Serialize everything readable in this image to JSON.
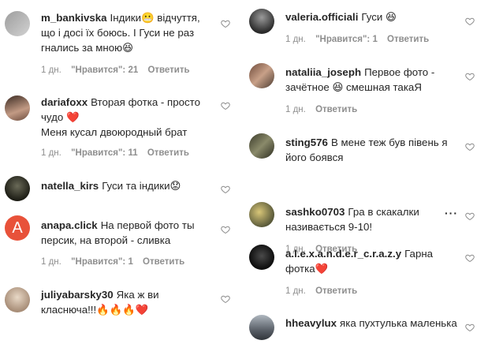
{
  "left": [
    {
      "username": "m_bankivska",
      "text": "Індики😬 відчуття, що і досі їх боюсь. І Гуси не раз гнались за мною😆",
      "time": "1 дн.",
      "likes": "\"Нравится\": 21",
      "reply": "Ответить"
    },
    {
      "username": "dariafoxx",
      "text": "Вторая фотка - просто чудо ❤️",
      "text2": "Меня кусал двоюродный брат",
      "time": "1 дн.",
      "likes": "\"Нравится\": 11",
      "reply": "Ответить"
    },
    {
      "username": "natella_kirs",
      "text": "Гуси та індики😟",
      "time": "",
      "likes": "",
      "reply": ""
    },
    {
      "username": "anapa.click",
      "text": "На первой фото ты персик, на второй - сливка",
      "avatar_letter": "A",
      "time": "1 дн.",
      "likes": "\"Нравится\": 1",
      "reply": "Ответить"
    },
    {
      "username": "juliyabarsky30",
      "text": "Яка ж ви класнюча!!!🔥🔥🔥❤️",
      "time": "",
      "likes": "",
      "reply": ""
    }
  ],
  "right": [
    {
      "username": "valeria.officiali",
      "text": "Гуси 😆",
      "time": "1 дн.",
      "likes": "\"Нравится\": 1",
      "reply": "Ответить"
    },
    {
      "username": "nataliia_joseph",
      "text": "Первое фото - зачётное 😆 смешная такаЯ",
      "time": "1 дн.",
      "likes": "",
      "reply": "Ответить"
    },
    {
      "username": "sting576",
      "text": "В мене теж був півень я його боявся",
      "time": "",
      "likes": "",
      "reply": ""
    },
    {
      "username": "sashko0703",
      "text": "Гра в скакалки називається 9-10!",
      "time": "1 дн.",
      "likes": "",
      "reply": "Ответить"
    },
    {
      "username": "a.l.e.x.a.n.d.e.r_c.r.a.z.y",
      "text": "Гарна фотка❤️",
      "time": "1 дн.",
      "likes": "",
      "reply": "Ответить"
    },
    {
      "username": "hheavylux",
      "text": "яка пухтулька маленька",
      "time": "",
      "likes": "",
      "reply": ""
    }
  ],
  "icons": {
    "like": "heart-outline-icon",
    "more": "more-options-icon"
  },
  "more_glyph": "···",
  "colors": {
    "text": "#262626",
    "meta": "#8e8e8e",
    "heart_stroke": "#8e8e8e",
    "anapa_avatar": "#e8523a"
  }
}
